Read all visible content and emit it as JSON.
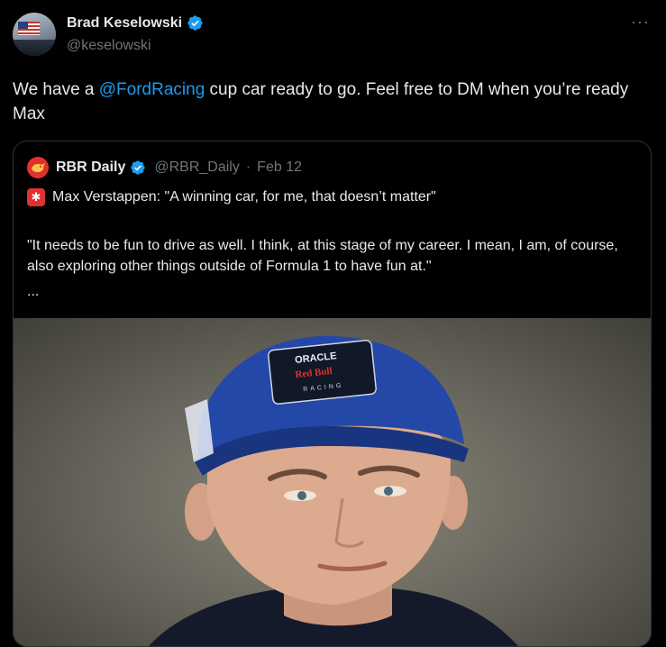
{
  "tweet": {
    "author_name": "Brad Keselowski",
    "author_handle": "@keselowski",
    "more_icon": "more-horizontal-icon",
    "text_before": "We have a ",
    "mention": "@FordRacing",
    "text_after": " cup car ready to go. Feel free to DM when you’re ready Max"
  },
  "quote": {
    "author_name": "RBR Daily",
    "author_handle": "@RBR_Daily",
    "separator": "·",
    "date": "Feb 12",
    "title": "Max Verstappen: \"A winning car, for me, that doesn’t matter\"",
    "body": "\"It needs to be fun to drive as well. I think, at this stage of my career. I mean, I am, of course, also exploring other things outside of Formula 1 to have fun at.\"",
    "ellipsis": "...",
    "photo": {
      "cap_text_top": "ORACLE",
      "cap_text_mid": "Red Bull",
      "cap_text_bottom": "RACING"
    }
  },
  "colors": {
    "background": "#000000",
    "text": "#e7e9ea",
    "muted": "#71767b",
    "link": "#1d9bf0",
    "verified": "#1d9bf0",
    "cap_blue": "#2448a8"
  }
}
